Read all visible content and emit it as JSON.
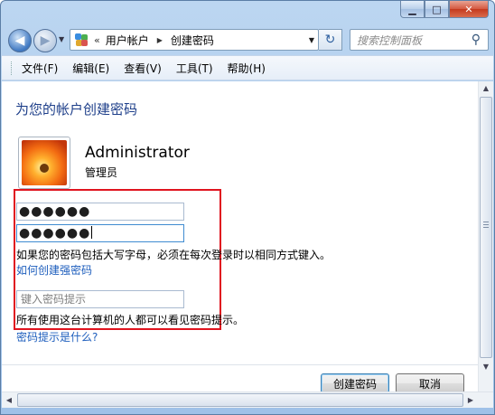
{
  "window": {
    "caption_buttons": {
      "minimize": "▁",
      "maximize": "□",
      "close": "✕"
    }
  },
  "nav": {
    "back_icon": "◀",
    "forward_icon": "▶",
    "history_drop_icon": "▼"
  },
  "address": {
    "chevron": "«",
    "breadcrumb": [
      "用户帐户",
      "创建密码"
    ],
    "separator": "▶",
    "dropdown_icon": "▼",
    "refresh_icon": "↻"
  },
  "search": {
    "placeholder": "搜索控制面板",
    "icon": "⚲"
  },
  "menu": {
    "items": [
      "文件(F)",
      "编辑(E)",
      "查看(V)",
      "工具(T)",
      "帮助(H)"
    ]
  },
  "main": {
    "title": "为您的帐户创建密码",
    "user": {
      "name": "Administrator",
      "role": "管理员"
    },
    "password": {
      "masked_value": "●●●●●●",
      "confirm_masked_value": "●●●●●●"
    },
    "caps_note": "如果您的密码包括大写字母，必须在每次登录时以相同方式键入。",
    "strong_password_link": "如何创建强密码",
    "hint": {
      "placeholder": "键入密码提示"
    },
    "hint_note": "所有使用这台计算机的人都可以看见密码提示。",
    "hint_help_link": "密码提示是什么?",
    "buttons": {
      "create": "创建密码",
      "cancel": "取消"
    }
  },
  "colors": {
    "title_blue": "#1e3f8a",
    "link_blue": "#1e5ebd",
    "highlight_box": "#e0141f"
  },
  "scroll": {
    "up": "▲",
    "down": "▼",
    "left": "◀",
    "right": "▶"
  }
}
